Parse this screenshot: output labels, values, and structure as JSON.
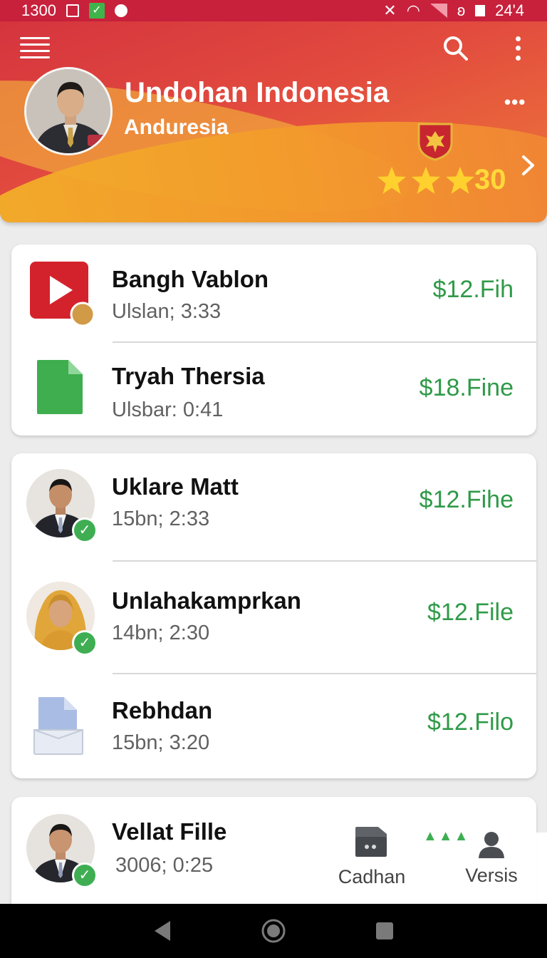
{
  "status_bar": {
    "time": "1300",
    "right_text": "24'4"
  },
  "header": {
    "title": "Undohan Indonesia",
    "subtitle": "Anduresia",
    "rating_count": "30",
    "stars": 3,
    "more_label": "•••"
  },
  "card1": {
    "items": [
      {
        "title": "Bangh Vablon",
        "subtitle": "Ulslan; 3:33",
        "price": "$12.Fih",
        "icon": "video-play-icon"
      },
      {
        "title": "Tryah Thersia",
        "subtitle": "Ulsbar: 0:41",
        "price": "$18.Fine",
        "icon": "green-document-icon"
      }
    ]
  },
  "card2": {
    "items": [
      {
        "title": "Uklare Matt",
        "subtitle": "15bn; 2:33",
        "price": "$12.Fihe",
        "icon": "avatar-man",
        "verified": true
      },
      {
        "title": "Unlahakamprkan",
        "subtitle": "14bn; 2:30",
        "price": "$12.File",
        "icon": "avatar-woman-hijab",
        "verified": true
      },
      {
        "title": "Rebhdan",
        "subtitle": "15bn; 3:20",
        "price": "$12.Filo",
        "icon": "blue-folder-icon"
      }
    ]
  },
  "card3": {
    "items": [
      {
        "title": "Vellat Fille",
        "subtitle": "3006; 0:25",
        "icon": "avatar-man-2",
        "verified": true
      }
    ]
  },
  "bottom_nav": {
    "items": [
      {
        "label": "Cadhan",
        "icon": "wallet-icon"
      },
      {
        "label": "Versis",
        "icon": "person-icon"
      }
    ],
    "mini_label": "▲▲▲"
  },
  "colors": {
    "header_red": "#d5343e",
    "header_orange": "#ee7a3a",
    "price_green": "#2f9a48",
    "star_gold": "#ffd93a",
    "badge_green": "#3fae53"
  }
}
